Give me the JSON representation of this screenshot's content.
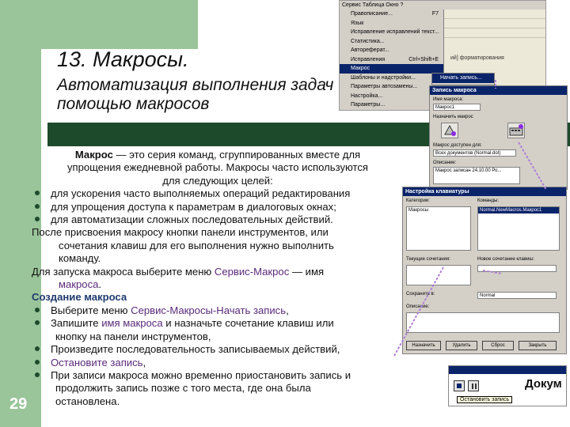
{
  "slide": {
    "number": "29",
    "title": "13. Макросы.",
    "subtitle": "Автоматизация выполнения задач с помощью макросов",
    "lines": [
      {
        "type": "center",
        "runs": [
          {
            "t": "Макрос",
            "b": true
          },
          {
            "t": " — это серия команд, сгруппированных вместе для"
          }
        ]
      },
      {
        "type": "center",
        "runs": [
          {
            "t": "упрощения ежедневной работы. Макросы часто используются"
          }
        ]
      },
      {
        "type": "center",
        "runs": [
          {
            "t": "для следующих целей:"
          }
        ]
      },
      {
        "type": "bullet",
        "runs": [
          {
            "t": "для ускорения часто выполняемых операций редактирования"
          }
        ]
      },
      {
        "type": "bullet",
        "runs": [
          {
            "t": "для упрощения доступа к параметрам в диалоговых окнах;"
          }
        ]
      },
      {
        "type": "bullet",
        "runs": [
          {
            "t": "для автоматизации сложных последовательных действий."
          }
        ]
      },
      {
        "type": "plain",
        "runs": [
          {
            "t": "После присвоения макросу кнопки панели инструментов, или"
          }
        ]
      },
      {
        "type": "indent1",
        "runs": [
          {
            "t": "сочетания клавиш для его выполнения нужно выполнить"
          }
        ]
      },
      {
        "type": "indent1",
        "runs": [
          {
            "t": "команду."
          }
        ]
      },
      {
        "type": "plain",
        "runs": [
          {
            "t": "Для запуска макроса выберите меню "
          },
          {
            "t": "Сервис-Макрос",
            "c": "#5a2a7a"
          },
          {
            "t": " — имя"
          }
        ]
      },
      {
        "type": "indent1",
        "runs": [
          {
            "t": "макроса",
            "c": "#5a2a7a"
          },
          {
            "t": "."
          }
        ]
      },
      {
        "type": "plain",
        "runs": [
          {
            "t": "Создание макроса",
            "b": true,
            "c": "#1e3a6e"
          }
        ]
      },
      {
        "type": "bullet",
        "runs": [
          {
            "t": "Выберите меню "
          },
          {
            "t": "Сервис-Макросы-Начать запись",
            "c": "#5a2a7a"
          },
          {
            "t": ","
          }
        ]
      },
      {
        "type": "bullet",
        "runs": [
          {
            "t": "Запишите "
          },
          {
            "t": "имя макроса",
            "c": "#5a2a7a"
          },
          {
            "t": " и назначьте сочетание клавиш или"
          }
        ]
      },
      {
        "type": "indent2",
        "runs": [
          {
            "t": "кнопку на панели инструментов,"
          }
        ]
      },
      {
        "type": "bullet",
        "runs": [
          {
            "t": "Произведите последовательность записываемых действий,"
          }
        ]
      },
      {
        "type": "bullet",
        "runs": [
          {
            "t": "Остановите запись",
            "c": "#5a2a7a"
          },
          {
            "t": ","
          }
        ]
      },
      {
        "type": "bullet",
        "runs": [
          {
            "t": "При записи макроса можно временно приостановить запись и"
          }
        ]
      },
      {
        "type": "indent2",
        "runs": [
          {
            "t": "продолжить запись позже с того места, где она была"
          }
        ]
      },
      {
        "type": "indent2",
        "runs": [
          {
            "t": "остановлена."
          }
        ]
      }
    ]
  },
  "menu_shot": {
    "tabs": "Сервис   Таблица   Окно   ?",
    "items": [
      {
        "label": "Правописание...",
        "shortcut": "F7",
        "selected": false
      },
      {
        "label": "Язык",
        "shortcut": "",
        "selected": false
      },
      {
        "label": "Исправление исправлений текст...",
        "shortcut": "",
        "selected": false
      },
      {
        "label": "Статистика...",
        "shortcut": "",
        "selected": false
      },
      {
        "label": "Автореферат...",
        "shortcut": "",
        "selected": false
      },
      {
        "label": "Исправления",
        "shortcut": "Ctrl+Shift+E",
        "selected": false
      },
      {
        "label": "Макрос",
        "shortcut": "",
        "selected": true
      },
      {
        "label": "Шаблоны и надстройки...",
        "shortcut": "",
        "selected": false
      },
      {
        "label": "Параметры автозамены...",
        "shortcut": "",
        "selected": false
      },
      {
        "label": "Настройка...",
        "shortcut": "",
        "selected": false
      },
      {
        "label": "Параметры...",
        "shortcut": "",
        "selected": false
      }
    ],
    "submenu_item": "Начать запись...",
    "doc_text": "ий] форматирования"
  },
  "record_dialog": {
    "title": "Запись макроса",
    "name_label": "Имя макроса:",
    "name_value": "Макрос1",
    "assign_label": "Назначить макрос",
    "store_label": "Макрос доступен для:",
    "store_value": "Всех документов (Normal.dot)",
    "desc_label": "Описание:",
    "desc_value": "Макрос записан 24.10.00 Ро..."
  },
  "keyboard_dialog": {
    "title": "Настройка клавиатуры",
    "cat_label": "Категории:",
    "cat_item": "Макросы",
    "cmd_label": "Команды:",
    "cmd_item": "Normal.NewMacros.Макрос1",
    "key_label": "Новое сочетание клавиш:",
    "current_label": "Текущие сочетания:",
    "save_label": "Сохранить в:",
    "save_value": "Normal",
    "desc_label": "Описание:",
    "btn_assign": "Назначить",
    "btn_delete": "Удалить",
    "btn_reset": "Сброс",
    "btn_close": "Закрыть"
  },
  "stop_toolbar": {
    "tooltip": "Остановить запись",
    "doc_word": "Докум"
  }
}
